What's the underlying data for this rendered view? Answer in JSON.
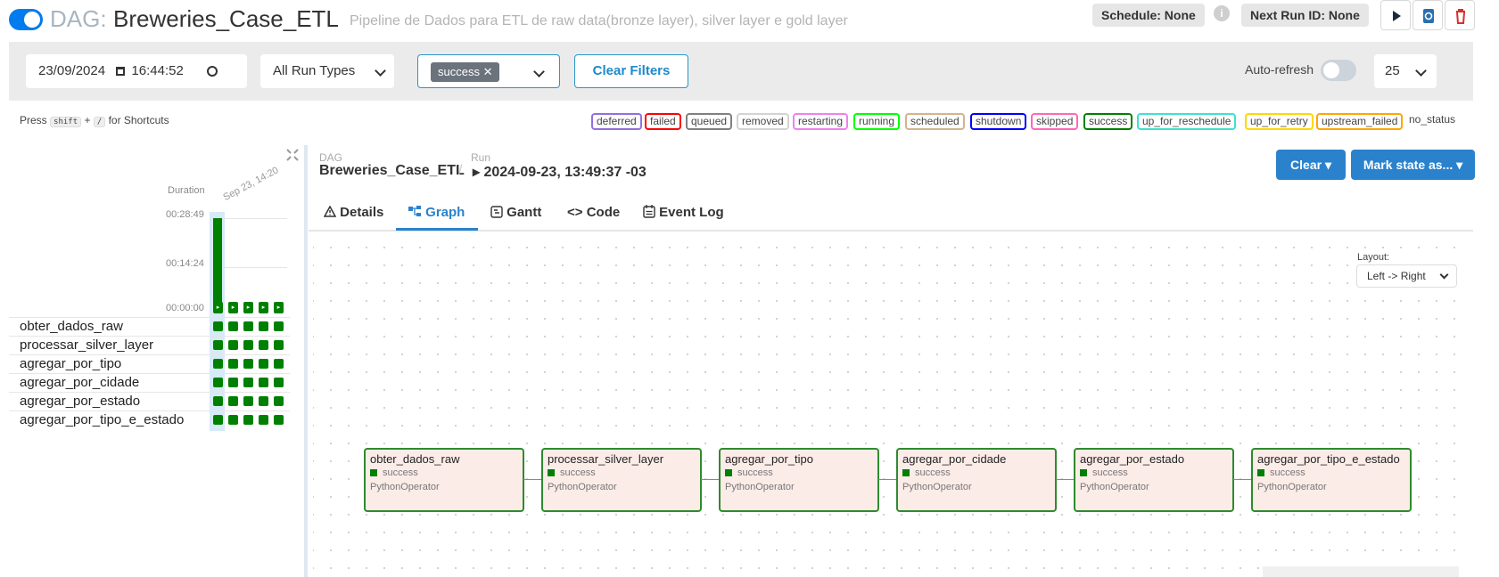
{
  "header": {
    "dag_prefix": "DAG:",
    "dag_id": "Breweries_Case_ETL",
    "description": "Pipeline de Dados para ETL de raw data(bronze layer), silver layer e gold layer",
    "schedule": "Schedule: None",
    "next_run": "Next Run ID: None",
    "info": "i"
  },
  "filters": {
    "date": "23/09/2024",
    "time": "16:44:52",
    "run_type": "All Run Types",
    "state_chip": "success",
    "clear_filters": "Clear Filters",
    "auto_refresh": "Auto-refresh",
    "page_size": "25"
  },
  "shortcuts": {
    "press": "Press",
    "key1": "shift",
    "plus": "+",
    "key2": "/",
    "suffix": "for Shortcuts"
  },
  "legend": [
    {
      "label": "deferred",
      "color": "#9370db"
    },
    {
      "label": "failed",
      "color": "#ff0000"
    },
    {
      "label": "queued",
      "color": "#808080"
    },
    {
      "label": "removed",
      "color": "#d3d3d3"
    },
    {
      "label": "restarting",
      "color": "#ee82ee"
    },
    {
      "label": "running",
      "color": "#00ff00"
    },
    {
      "label": "scheduled",
      "color": "#d2b48c"
    },
    {
      "label": "shutdown",
      "color": "#0000ff"
    },
    {
      "label": "skipped",
      "color": "#ff69b4"
    },
    {
      "label": "success",
      "color": "#008000"
    },
    {
      "label": "up_for_reschedule",
      "color": "#40e0d0"
    },
    {
      "label": "up_for_retry",
      "color": "#ffd700"
    },
    {
      "label": "upstream_failed",
      "color": "#ffa500"
    },
    {
      "label": "no_status",
      "color": "none"
    }
  ],
  "grid": {
    "duration_label": "Duration",
    "ticks": [
      "00:28:49",
      "00:14:24",
      "00:00:00"
    ],
    "run_date": "Sep 23, 14:20",
    "run_duration_fraction": 1.0,
    "tasks": [
      "obter_dados_raw",
      "processar_silver_layer",
      "agregar_por_tipo",
      "agregar_por_cidade",
      "agregar_por_estado",
      "agregar_por_tipo_e_estado"
    ]
  },
  "breadcrumb": {
    "dag_label": "DAG",
    "dag_value": "Breweries_Case_ETL",
    "sep": "/",
    "run_label": "Run",
    "run_value": "▸ 2024-09-23, 13:49:37 -03"
  },
  "actions": {
    "clear": "Clear ▾",
    "mark_state": "Mark state as... ▾"
  },
  "tabs": [
    "Details",
    "Graph",
    "Gantt",
    "Code",
    "Event Log"
  ],
  "graph": {
    "layout_label": "Layout:",
    "layout_value": "Left -> Right",
    "nodes": [
      {
        "name": "obter_dados_raw",
        "state": "success",
        "operator": "PythonOperator"
      },
      {
        "name": "processar_silver_layer",
        "state": "success",
        "operator": "PythonOperator"
      },
      {
        "name": "agregar_por_tipo",
        "state": "success",
        "operator": "PythonOperator"
      },
      {
        "name": "agregar_por_cidade",
        "state": "success",
        "operator": "PythonOperator"
      },
      {
        "name": "agregar_por_estado",
        "state": "success",
        "operator": "PythonOperator"
      },
      {
        "name": "agregar_por_tipo_e_estado",
        "state": "success",
        "operator": "PythonOperator"
      }
    ]
  },
  "colors": {
    "accent": "#017cee",
    "success": "#008000",
    "button": "#2a82cc"
  }
}
